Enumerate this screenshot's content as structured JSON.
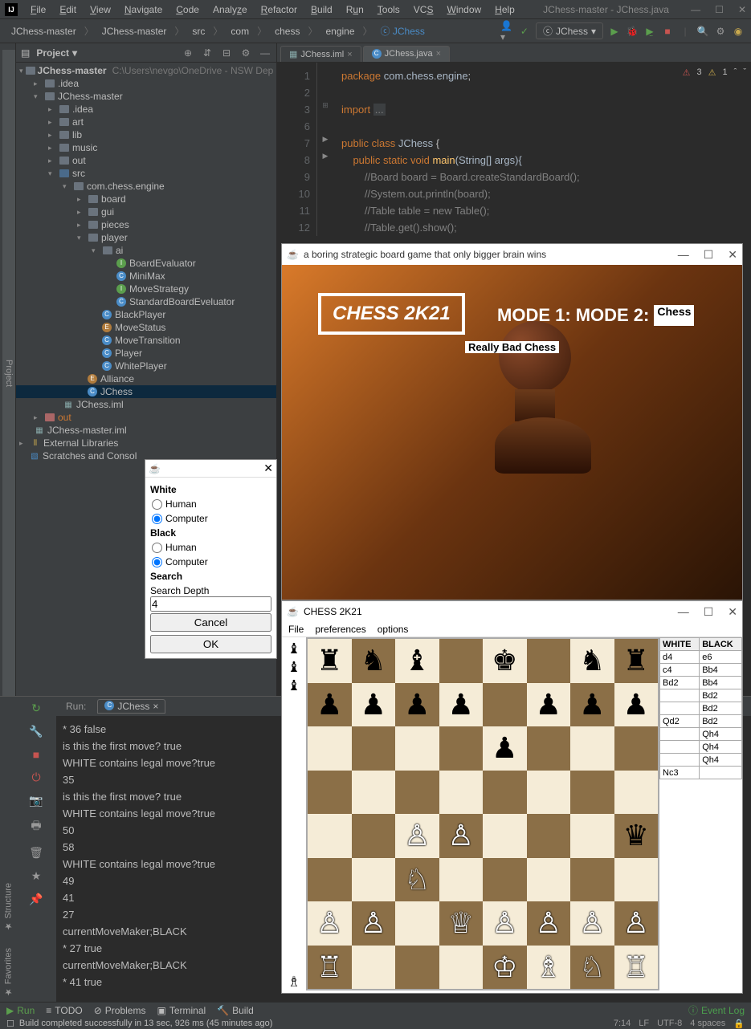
{
  "window": {
    "title": "JChess-master - JChess.java",
    "menus": [
      "File",
      "Edit",
      "View",
      "Navigate",
      "Code",
      "Analyze",
      "Refactor",
      "Build",
      "Run",
      "Tools",
      "VCS",
      "Window",
      "Help"
    ]
  },
  "breadcrumb": [
    "JChess-master",
    "JChess-master",
    "src",
    "com",
    "chess",
    "engine",
    "JChess"
  ],
  "runConfig": "JChess",
  "sidebar": {
    "title": "Project",
    "rootHint": "C:\\Users\\nevgo\\OneDrive - NSW Dep"
  },
  "tree": {
    "root": "JChess-master",
    "idea": ".idea",
    "jchessmaster": "JChess-master",
    "idea2": ".idea",
    "art": "art",
    "lib": "lib",
    "music": "music",
    "out": "out",
    "src": "src",
    "pkg": "com.chess.engine",
    "board": "board",
    "gui": "gui",
    "pieces": "pieces",
    "player": "player",
    "ai": "ai",
    "be": "BoardEvaluator",
    "mm": "MiniMax",
    "ms": "MoveStrategy",
    "sbe": "StandardBoardEveluator",
    "bp": "BlackPlayer",
    "mst": "MoveStatus",
    "mt": "MoveTransition",
    "pl": "Player",
    "wp": "WhitePlayer",
    "all": "Alliance",
    "jc": "JChess",
    "iml": "JChess.iml",
    "out2": "out",
    "iml2": "JChess-master.iml",
    "ext": "External Libraries",
    "scratch": "Scratches and Consol"
  },
  "tabs": [
    {
      "name": "JChess.iml",
      "active": false
    },
    {
      "name": "JChess.java",
      "active": true
    }
  ],
  "editor": {
    "errors": "3",
    "warnings": "1",
    "p": "package ",
    "pkg": "com.chess.engine",
    "imp": "import ",
    "dots": "...",
    "pub": "public ",
    "cls": "class ",
    "jc": "JChess ",
    "st": "static ",
    "vd": "void ",
    "mn": "main",
    "arg": "(String[] args){",
    "c1": "//Board board = Board.createStandardBoard();",
    "c2": "//System.out.println(board);",
    "c3": "//Table table = new Table();",
    "c4": "//Table.get().show();"
  },
  "dlg1": {
    "white": "White",
    "black": "Black",
    "human": "Human",
    "computer": "Computer",
    "search": "Search",
    "depth": "Search Depth",
    "depthVal": "4",
    "cancel": "Cancel",
    "ok": "OK"
  },
  "splash": {
    "title": "a boring strategic board game that only bigger brain wins",
    "logo": "CHESS 2K21",
    "m1": "MODE 1:",
    "m2": "MODE 2:",
    "sel": "Chess",
    "bad": "Really Bad Chess"
  },
  "game": {
    "title": "CHESS 2K21",
    "menu": [
      "File",
      "preferences",
      "options"
    ],
    "headers": {
      "w": "WHITE",
      "b": "BLACK"
    },
    "moves": [
      {
        "w": "d4",
        "b": "e6"
      },
      {
        "w": "c4",
        "b": "Bb4"
      },
      {
        "w": "Bd2",
        "b": "Bb4"
      },
      {
        "w": "",
        "b": "Bd2"
      },
      {
        "w": "",
        "b": "Bd2"
      },
      {
        "w": "Qd2",
        "b": "Bd2"
      },
      {
        "w": "",
        "b": "Qh4"
      },
      {
        "w": "",
        "b": "Qh4"
      },
      {
        "w": "",
        "b": "Qh4"
      },
      {
        "w": "Nc3",
        "b": ""
      }
    ]
  },
  "console": {
    "tab": "JChess",
    "label": "Run:",
    "lines": [
      "* 36 false",
      "is this the first move? true",
      "WHITE contains legal move?true",
      "35",
      "is this the first move? true",
      "WHITE contains legal move?true",
      "50",
      "58",
      "WHITE contains legal move?true",
      "49",
      "41",
      "27",
      "currentMoveMaker;BLACK",
      "* 27 true",
      "currentMoveMaker;BLACK",
      "* 41 true"
    ]
  },
  "bottomTools": {
    "run": "Run",
    "todo": "TODO",
    "problems": "Problems",
    "terminal": "Terminal",
    "build": "Build",
    "event": "Event Log"
  },
  "status": {
    "msg": "Build completed successfully in 13 sec, 926 ms (45 minutes ago)",
    "pos": "7:14",
    "lf": "LF",
    "enc": "UTF-8",
    "indent": "4 spaces"
  },
  "gutters": {
    "project": "Project",
    "structure": "Structure",
    "favorites": "Favorites"
  }
}
